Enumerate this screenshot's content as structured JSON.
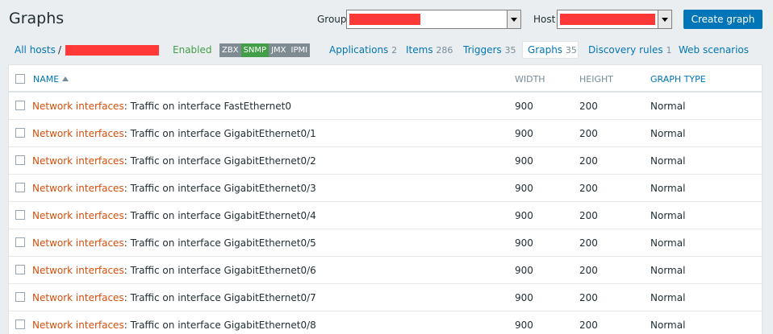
{
  "header": {
    "title": "Graphs",
    "group_label": "Group",
    "host_label": "Host",
    "create_button": "Create graph"
  },
  "nav": {
    "all_hosts": "All hosts",
    "separator": "/",
    "status": "Enabled",
    "badges": [
      "ZBX",
      "SNMP",
      "JMX",
      "IPMI"
    ],
    "tabs": [
      {
        "label": "Applications",
        "count": "2"
      },
      {
        "label": "Items",
        "count": "286"
      },
      {
        "label": "Triggers",
        "count": "35"
      },
      {
        "label": "Graphs",
        "count": "35"
      },
      {
        "label": "Discovery rules",
        "count": "1"
      },
      {
        "label": "Web scenarios",
        "count": ""
      }
    ]
  },
  "colors": {
    "accent": "#0275b8",
    "link_prefix": "#d64e0a",
    "enabled": "#429e47",
    "redaction": "#ff3838"
  },
  "table": {
    "columns": {
      "name": "NAME",
      "width": "WIDTH",
      "height": "HEIGHT",
      "graph_type": "GRAPH TYPE"
    },
    "rows": [
      {
        "prefix": "Network interfaces",
        "name": "Traffic on interface FastEthernet0",
        "width": "900",
        "height": "200",
        "type": "Normal"
      },
      {
        "prefix": "Network interfaces",
        "name": "Traffic on interface GigabitEthernet0/1",
        "width": "900",
        "height": "200",
        "type": "Normal"
      },
      {
        "prefix": "Network interfaces",
        "name": "Traffic on interface GigabitEthernet0/2",
        "width": "900",
        "height": "200",
        "type": "Normal"
      },
      {
        "prefix": "Network interfaces",
        "name": "Traffic on interface GigabitEthernet0/3",
        "width": "900",
        "height": "200",
        "type": "Normal"
      },
      {
        "prefix": "Network interfaces",
        "name": "Traffic on interface GigabitEthernet0/4",
        "width": "900",
        "height": "200",
        "type": "Normal"
      },
      {
        "prefix": "Network interfaces",
        "name": "Traffic on interface GigabitEthernet0/5",
        "width": "900",
        "height": "200",
        "type": "Normal"
      },
      {
        "prefix": "Network interfaces",
        "name": "Traffic on interface GigabitEthernet0/6",
        "width": "900",
        "height": "200",
        "type": "Normal"
      },
      {
        "prefix": "Network interfaces",
        "name": "Traffic on interface GigabitEthernet0/7",
        "width": "900",
        "height": "200",
        "type": "Normal"
      },
      {
        "prefix": "Network interfaces",
        "name": "Traffic on interface GigabitEthernet0/8",
        "width": "900",
        "height": "200",
        "type": "Normal"
      }
    ]
  }
}
